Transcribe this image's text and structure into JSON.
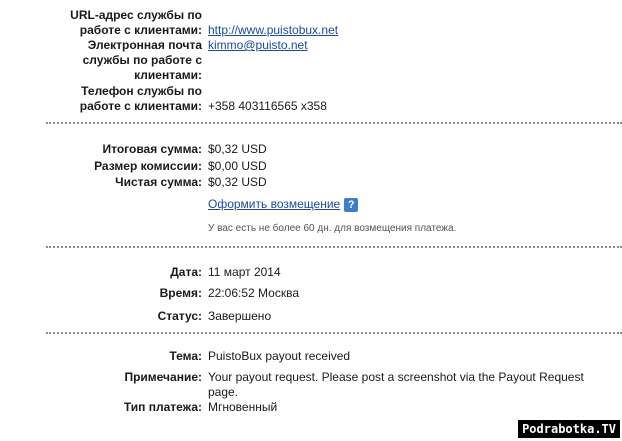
{
  "contacts": {
    "url_label_1": "URL-адрес службы по",
    "url_label_2": "работе с клиентами:",
    "url_value": "http://www.puistobux.net",
    "email_label_1": "Электронная почта",
    "email_label_2": "службы по работе с",
    "email_label_3": "клиентами:",
    "email_value": "kimmo@puisto.net",
    "phone_label_1": "Телефон службы по",
    "phone_label_2": "работе с клиентами:",
    "phone_value": "+358 403116565 x358"
  },
  "amounts": {
    "total_label": "Итоговая сумма:",
    "total_value": "$0,32 USD",
    "fee_label": "Размер комиссии:",
    "fee_value": "$0,00 USD",
    "net_label": "Чистая сумма:",
    "net_value": "$0,32 USD",
    "refund_link": "Оформить возмещение",
    "help_icon": "?",
    "refund_note": "У вас есть не более 60 дн. для возмещения платежа."
  },
  "details": {
    "date_label": "Дата:",
    "date_value": "11 март 2014",
    "time_label": "Время:",
    "time_value": "22:06:52 Москва",
    "status_label": "Статус:",
    "status_value": "Завершено"
  },
  "message": {
    "subject_label": "Тема:",
    "subject_value": "PuistoBux payout received",
    "note_label": "Примечание:",
    "note_line1": "Your payout request. Please post a screenshot via the Payout Request",
    "note_line2": "page.",
    "type_label": "Тип платежа:",
    "type_value": "Мгновенный"
  },
  "watermark": "Podrabotka.TV"
}
